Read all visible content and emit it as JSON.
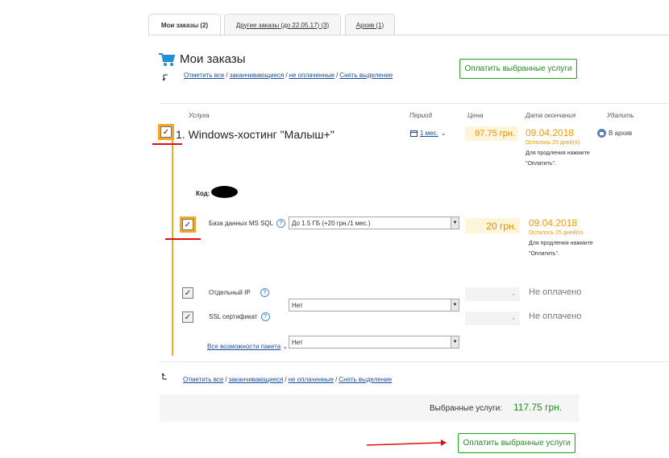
{
  "tabs": [
    {
      "label": "Мои заказы (2)",
      "active": true
    },
    {
      "label": "Другие заказы (до 22.05.17) (3)",
      "active": false
    },
    {
      "label": "Архив (1)",
      "active": false
    }
  ],
  "header": {
    "title": "Мои заказы",
    "pay_button": "Оплатить выбранные услуги"
  },
  "select_links": {
    "all": "Отметить все",
    "ending": "заканчивающиеся",
    "unpaid": "не оплаченные",
    "clear": "Снять выделение",
    "separator": "/"
  },
  "columns": {
    "service": "Услуга",
    "period": "Период",
    "price": "Цена",
    "end_date": "Дата окончания",
    "delete": "Удалить"
  },
  "order": {
    "title": "1. Windows-хостинг \"Малыш+\"",
    "period": "1 мес.",
    "price": "97.75 грн.",
    "end_date": "09.04.2018",
    "remaining": "Осталось 25 дней(я).",
    "note": "Для продления нажмите \"Оплатить\".",
    "archive_label": "В архив",
    "code_label": "Код:"
  },
  "addons": [
    {
      "label": "База данных MS SQL",
      "select": "До 1.5 ГБ (+20 грн./1 мес.)",
      "price": "20 грн.",
      "end_date": "09.04.2018",
      "remaining": "Осталось 25 дней(я).",
      "note": "Для продления нажмите \"Оплатить\"."
    },
    {
      "label": "Отдельный IP",
      "select": "Нет",
      "price": "-",
      "status": "Не оплачено"
    },
    {
      "label": "SSL сертификат",
      "select": "Нет",
      "price": "-",
      "status": "Не оплачено"
    }
  ],
  "package_link": "Все возможности пакета",
  "totals": {
    "label": "Выбранные услуги:",
    "value": "117.75 грн."
  },
  "bottom_button": "Оплатить выбранные услуги",
  "colors": {
    "accent_green": "#238c23",
    "highlight_orange": "#f5a623",
    "annotation_red": "#e01010",
    "link_blue": "#1a4d99"
  }
}
